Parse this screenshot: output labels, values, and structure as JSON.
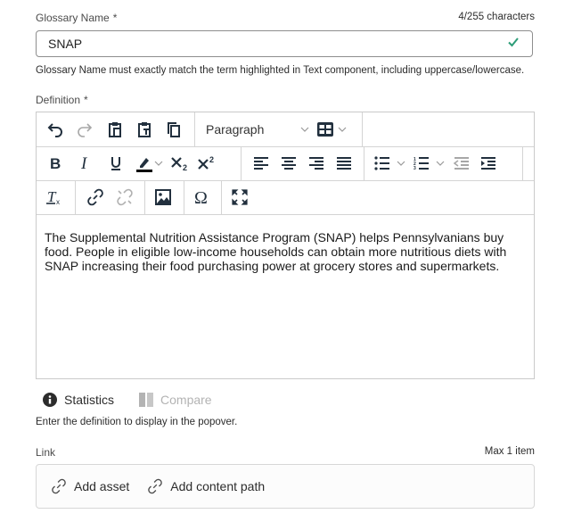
{
  "glossary_name": {
    "label": "Glossary Name",
    "required_mark": "*",
    "char_count": "4/255 characters",
    "value": "SNAP",
    "valid_icon": "checkmark-icon",
    "valid_color": "#2d9d78",
    "help_text": "Glossary Name must exactly match the term highlighted in Text component, including uppercase/lowercase."
  },
  "definition": {
    "label": "Definition",
    "required_mark": "*",
    "toolbar": {
      "row1": [
        "undo-icon",
        "redo-icon",
        "paste-icon",
        "paste-as-text-icon",
        "copy-format-icon"
      ],
      "paragraph_select": "Paragraph",
      "table_icon": "table-icon",
      "row2": [
        "bold-icon",
        "italic-icon",
        "underline-icon",
        "highlight-icon",
        "subscript-icon",
        "superscript-icon",
        "align-left-icon",
        "align-center-icon",
        "align-right-icon",
        "justify-icon",
        "bullet-list-icon",
        "numbered-list-icon",
        "outdent-icon",
        "indent-icon"
      ],
      "row3": [
        "clear-format-icon",
        "link-icon",
        "unlink-icon",
        "image-icon",
        "special-char-icon",
        "fullscreen-icon"
      ]
    },
    "content": "The Supplemental Nutrition Assistance Program (SNAP) helps Pennsylvanians buy food. People in eligible low-income households can obtain more nutritious diets with SNAP increasing their food purchasing power at grocery stores and supermarkets.",
    "tabs": [
      {
        "label": "Statistics",
        "icon": "info-icon",
        "enabled": true
      },
      {
        "label": "Compare",
        "icon": "compare-icon",
        "enabled": false
      }
    ],
    "help_text": "Enter the definition to display in the popover."
  },
  "link": {
    "label": "Link",
    "max_text": "Max 1 item",
    "buttons": [
      {
        "label": "Add asset",
        "icon": "link-icon"
      },
      {
        "label": "Add content path",
        "icon": "link-icon"
      }
    ]
  }
}
